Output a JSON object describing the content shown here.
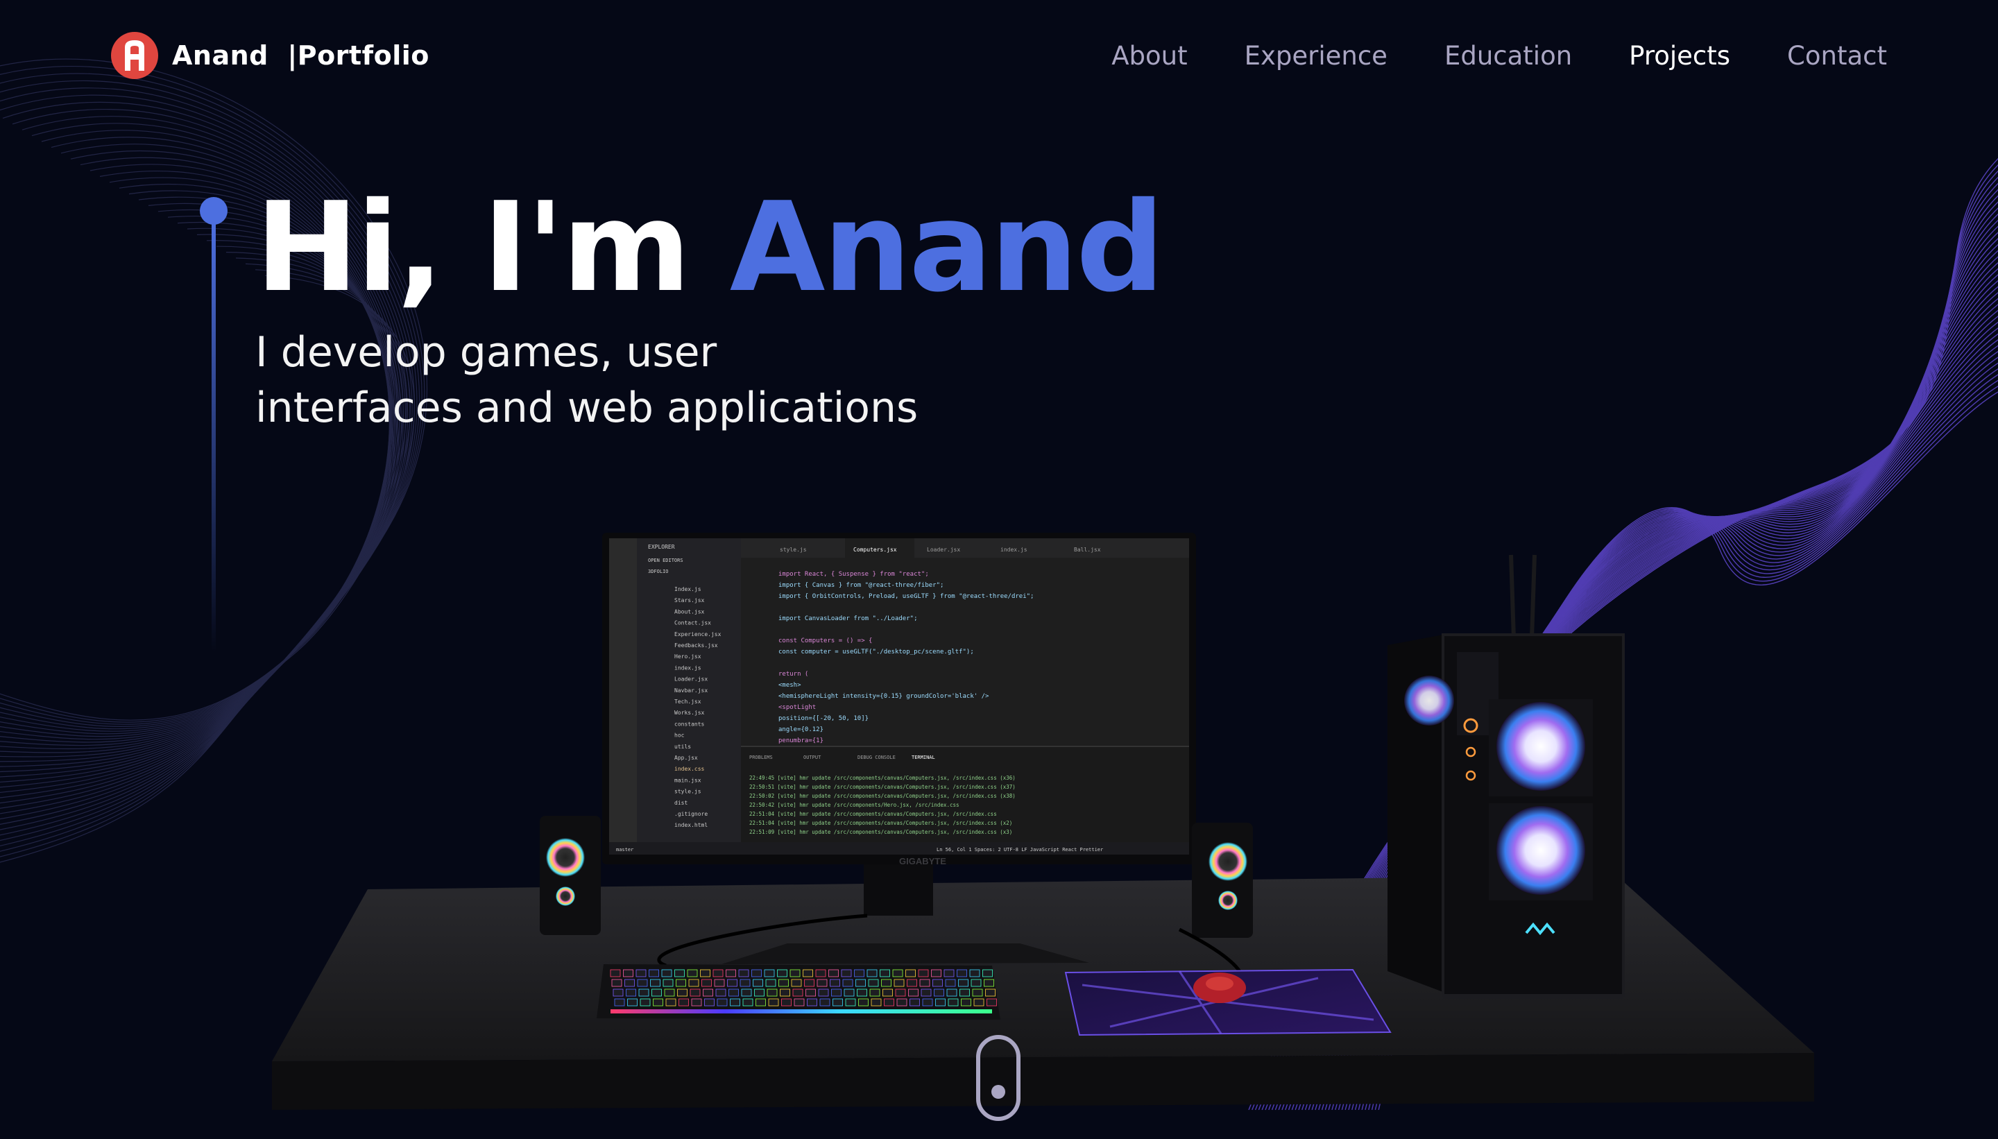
{
  "brand": {
    "name": "Anand",
    "separator": "|",
    "suffix": "Portfolio",
    "logo_icon": "logo-a-icon"
  },
  "nav": {
    "items": [
      {
        "label": "About",
        "active": false
      },
      {
        "label": "Experience",
        "active": false
      },
      {
        "label": "Education",
        "active": false
      },
      {
        "label": "Projects",
        "active": true
      },
      {
        "label": "Contact",
        "active": false
      }
    ]
  },
  "hero": {
    "greeting": "Hi, I'm ",
    "name": "Anand",
    "subtitle_line1": "I develop games, user",
    "subtitle_line2": "interfaces and web applications"
  },
  "editor": {
    "sidebar_title": "EXPLORER",
    "open_editors": "OPEN EDITORS",
    "folder": "3DFOLIO",
    "tabs": [
      "style.js",
      "Computers.jsx",
      "Loader.jsx",
      "index.js",
      "Ball.jsx"
    ],
    "files": [
      "Index.js",
      "Stars.jsx",
      "About.jsx",
      "Contact.jsx",
      "Experience.jsx",
      "Feedbacks.jsx",
      "Hero.jsx",
      "index.js",
      "Loader.jsx",
      "Navbar.jsx",
      "Tech.jsx",
      "Works.jsx",
      "constants",
      "hoc",
      "utils",
      "App.jsx",
      "index.css",
      "main.jsx",
      "style.js",
      "dist",
      ".gitignore",
      "index.html"
    ],
    "code_lines": [
      "import React, { Suspense } from \"react\";",
      "import { Canvas } from \"@react-three/fiber\";",
      "import { OrbitControls, Preload, useGLTF } from \"@react-three/drei\";",
      "",
      "import CanvasLoader from \"../Loader\";",
      "",
      "const Computers = () => {",
      "  const computer = useGLTF(\"./desktop_pc/scene.gltf\");",
      "",
      "  return (",
      "    <mesh>",
      "      <hemisphereLight intensity={0.15} groundColor='black' />",
      "      <spotLight",
      "        position={[-20, 50, 10]}",
      "        angle={0.12}",
      "        penumbra={1}"
    ],
    "panel_tabs": [
      "PROBLEMS",
      "OUTPUT",
      "DEBUG CONSOLE",
      "TERMINAL"
    ],
    "terminal_lines": [
      "22:49:45 [vite] hmr update /src/components/canvas/Computers.jsx, /src/index.css (x36)",
      "22:50:51 [vite] hmr update /src/components/canvas/Computers.jsx, /src/index.css (x37)",
      "22:50:02 [vite] hmr update /src/components/canvas/Computers.jsx, /src/index.css (x38)",
      "22:50:42 [vite] hmr update /src/components/Hero.jsx, /src/index.css",
      "22:51:04 [vite] hmr update /src/components/canvas/Computers.jsx, /src/index.css",
      "22:51:04 [vite] hmr update /src/components/canvas/Computers.jsx, /src/index.css (x2)",
      "22:51:09 [vite] hmr update /src/components/canvas/Computers.jsx, /src/index.css (x3)"
    ],
    "status_left": "master",
    "status_right": "Ln 56, Col 1   Spaces: 2   UTF-8   LF   JavaScript React   Prettier",
    "monitor_brand": "GIGABYTE"
  },
  "colors": {
    "background": "#050816",
    "accent": "#4d6fe0",
    "nav_inactive": "#aaa6c3",
    "logo_bg": "#e0463f",
    "wave": "#6b4ce6"
  }
}
